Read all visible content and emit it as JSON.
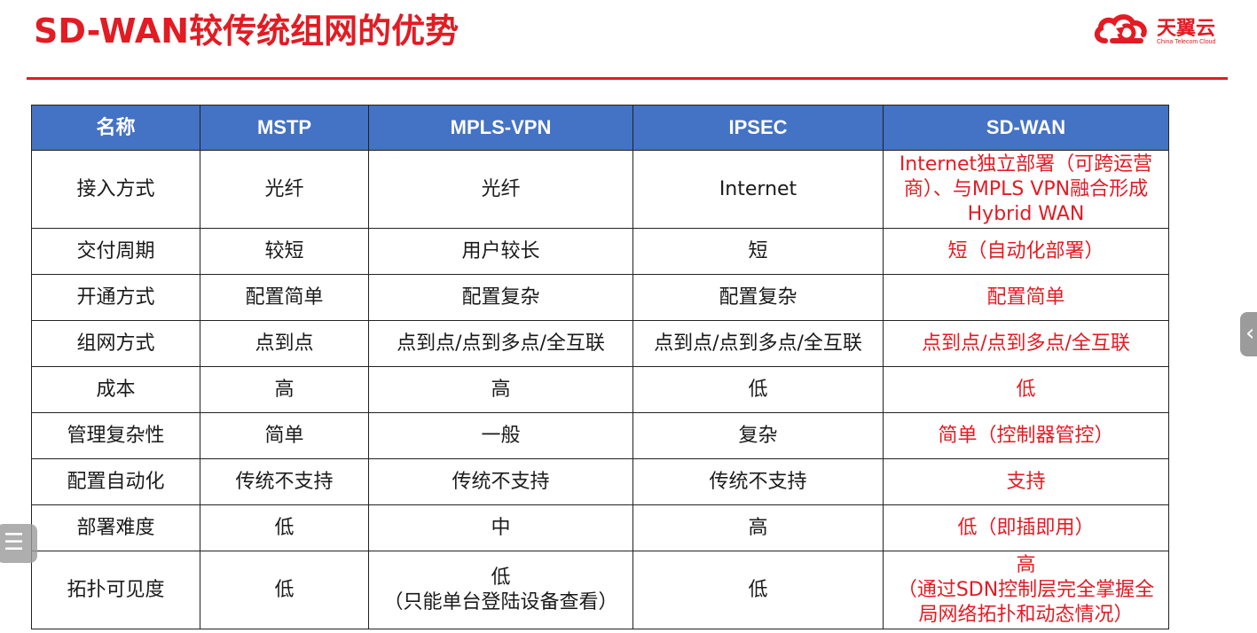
{
  "title": "SD-WAN较传统组网的优势",
  "logo": {
    "name": "天翼云",
    "subtitle": "China Telecom Cloud",
    "icon": "cloud-logo-icon"
  },
  "colors": {
    "accent": "#e31b23",
    "header_bg": "#4472c4",
    "header_text": "#ffffff"
  },
  "table": {
    "headers": [
      "名称",
      "MSTP",
      "MPLS-VPN",
      "IPSEC",
      "SD-WAN"
    ],
    "rows": [
      [
        "接入方式",
        "光纤",
        "光纤",
        "Internet",
        "Internet独立部署（可跨运营商）、与MPLS VPN融合形成Hybrid WAN"
      ],
      [
        "交付周期",
        "较短",
        "用户较长",
        "短",
        "短（自动化部署）"
      ],
      [
        "开通方式",
        "配置简单",
        "配置复杂",
        "配置复杂",
        "配置简单"
      ],
      [
        "组网方式",
        "点到点",
        "点到点/点到多点/全互联",
        "点到点/点到多点/全互联",
        "点到点/点到多点/全互联"
      ],
      [
        "成本",
        "高",
        "高",
        "低",
        "低"
      ],
      [
        "管理复杂性",
        "简单",
        "一般",
        "复杂",
        "简单（控制器管控）"
      ],
      [
        "配置自动化",
        "传统不支持",
        "传统不支持",
        "传统不支持",
        "支持"
      ],
      [
        "部署难度",
        "低",
        "中",
        "高",
        "低（即插即用）"
      ],
      [
        "拓扑可见度",
        "低",
        "低\n（只能单台登陆设备查看）",
        "低",
        "高\n（通过SDN控制层完全掌握全局网络拓扑和动态情况）"
      ]
    ]
  },
  "side_tab": {
    "icon": "chevron-left-icon",
    "glyph": "‹"
  },
  "menu_button": {
    "icon": "list-menu-icon",
    "glyph": "☰"
  }
}
